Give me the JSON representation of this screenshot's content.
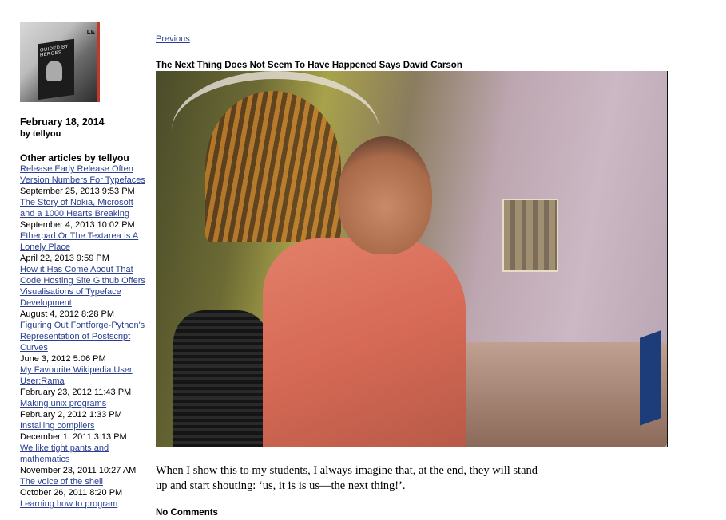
{
  "sidebar": {
    "avatar_lettering": {
      "poster": "GUIDED BY HEROES",
      "sign": "LE"
    },
    "date": "February 18, 2014",
    "byline": "by tellyou",
    "other_title": "Other articles by tellyou",
    "articles": [
      {
        "title": "Release Early Release Often Version Numbers For Typefaces",
        "date": "September 25, 2013 9:53 PM"
      },
      {
        "title": "The Story of Nokia, Microsoft and a 1000 Hearts Breaking",
        "date": "September 4, 2013 10:02 PM"
      },
      {
        "title": "Etherpad Or The Textarea Is A Lonely Place",
        "date": "April 22, 2013 9:59 PM"
      },
      {
        "title": "How it Has Come About That Code Hosting Site Github Offers Visualisations of Typeface Development",
        "date": "August 4, 2012 8:28 PM"
      },
      {
        "title": "Figuring Out Fontforge-Python's Representation of Postscript Curves",
        "date": "June 3, 2012 5:06 PM"
      },
      {
        "title": "My Favourite Wikipedia User User:Rama",
        "date": "February 23, 2012 11:43 PM"
      },
      {
        "title": "Making unix programs",
        "date": "February 2, 2012 1:33 PM"
      },
      {
        "title": "Installing compilers",
        "date": "December 1, 2011 3:13 PM"
      },
      {
        "title": "We like tight pants and mathematics",
        "date": "November 23, 2011 10:27 AM"
      },
      {
        "title": "The voice of the shell",
        "date": "October 26, 2011 8:20 PM"
      },
      {
        "title": "Learning how to program",
        "date": ""
      }
    ]
  },
  "main": {
    "prev_label": "Previous",
    "post_title": "The Next Thing Does Not Seem To Have Happened Says David Carson",
    "caption": "When I show this to my students, I always imagine that, at the end, they will stand up and start shouting: ‘us, it is is us—the next thing!’.",
    "comments_label": "No Comments"
  },
  "colors": {
    "link": "#2a3f8f",
    "text": "#000000",
    "background": "#ffffff"
  }
}
